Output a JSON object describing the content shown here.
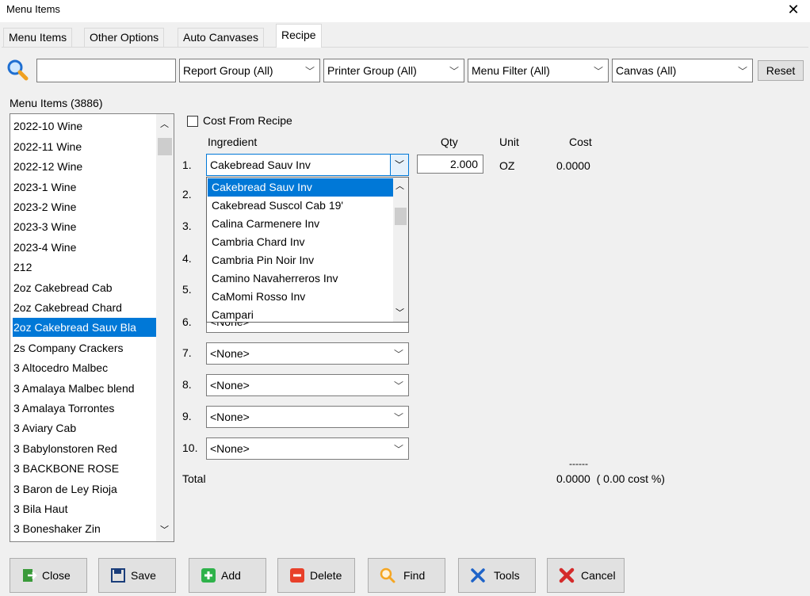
{
  "window": {
    "title": "Menu Items",
    "close_glyph": "✕"
  },
  "tabs": [
    {
      "label": "Menu Items",
      "active": false
    },
    {
      "label": "Other Options",
      "active": false
    },
    {
      "label": "Auto Canvases",
      "active": false
    },
    {
      "label": "Recipe",
      "active": true
    }
  ],
  "filters": {
    "search_value": "",
    "report_group": "Report Group (All)",
    "printer_group": "Printer Group (All)",
    "menu_filter": "Menu Filter (All)",
    "canvas": "Canvas (All)",
    "reset_label": "Reset"
  },
  "menu_list": {
    "label": "Menu Items  (3886)",
    "items": [
      "2022-10 Wine",
      "2022-11 Wine",
      "2022-12 Wine",
      "2023-1 Wine",
      "2023-2 Wine",
      "2023-3 Wine",
      "2023-4 Wine",
      "212",
      "2oz Cakebread Cab",
      "2oz Cakebread Chard",
      "2oz Cakebread Sauv Bla",
      "2s Company Crackers",
      "3 Altocedro Malbec",
      "3 Amalaya Malbec blend",
      "3 Amalaya Torrontes",
      "3 Aviary Cab",
      "3 Babylonstoren Red",
      "3 BACKBONE ROSE",
      "3 Baron de Ley Rioja",
      "3 Bila Haut",
      "3 Boneshaker Zin"
    ],
    "selected_index": 10
  },
  "recipe": {
    "cost_from_recipe_label": "Cost From Recipe",
    "cost_from_recipe_checked": false,
    "headers": {
      "ingredient": "Ingredient",
      "qty": "Qty",
      "unit": "Unit",
      "cost": "Cost"
    },
    "rows": [
      {
        "num": "1.",
        "ingredient": "Cakebread Sauv Inv",
        "qty": "2.000",
        "unit": "OZ",
        "cost": "0.0000"
      },
      {
        "num": "2.",
        "ingredient": ""
      },
      {
        "num": "3.",
        "ingredient": ""
      },
      {
        "num": "4.",
        "ingredient": ""
      },
      {
        "num": "5.",
        "ingredient": ""
      },
      {
        "num": "6.",
        "ingredient": "<None>"
      },
      {
        "num": "7.",
        "ingredient": "<None>"
      },
      {
        "num": "8.",
        "ingredient": "<None>"
      },
      {
        "num": "9.",
        "ingredient": "<None>"
      },
      {
        "num": "10.",
        "ingredient": "<None>"
      }
    ],
    "total_separator": "------",
    "total_label": "Total",
    "total_value": "0.0000  ( 0.00 cost %)"
  },
  "ingredient_dropdown": {
    "options": [
      "Cakebread Sauv Inv",
      "Cakebread Suscol Cab 19'",
      "Calina Carmenere Inv",
      "Cambria Chard Inv",
      "Cambria Pin Noir Inv",
      "Camino Navaherreros Inv",
      "CaMomi Rosso Inv",
      "Campari"
    ],
    "selected_index": 0
  },
  "bottom_buttons": [
    {
      "label": "Close",
      "icon": "close-door-icon"
    },
    {
      "label": "Save",
      "icon": "save-disk-icon"
    },
    {
      "label": "Add",
      "icon": "plus-icon"
    },
    {
      "label": "Delete",
      "icon": "minus-icon"
    },
    {
      "label": "Find",
      "icon": "magnifier-icon"
    },
    {
      "label": "Tools",
      "icon": "tools-icon"
    },
    {
      "label": "Cancel",
      "icon": "x-cancel-icon"
    }
  ],
  "colors": {
    "selection": "#0078d7",
    "add_green": "#2eb24a",
    "delete_red": "#e8402a",
    "find_orange": "#f5a623",
    "tools_blue": "#1e63c8"
  }
}
